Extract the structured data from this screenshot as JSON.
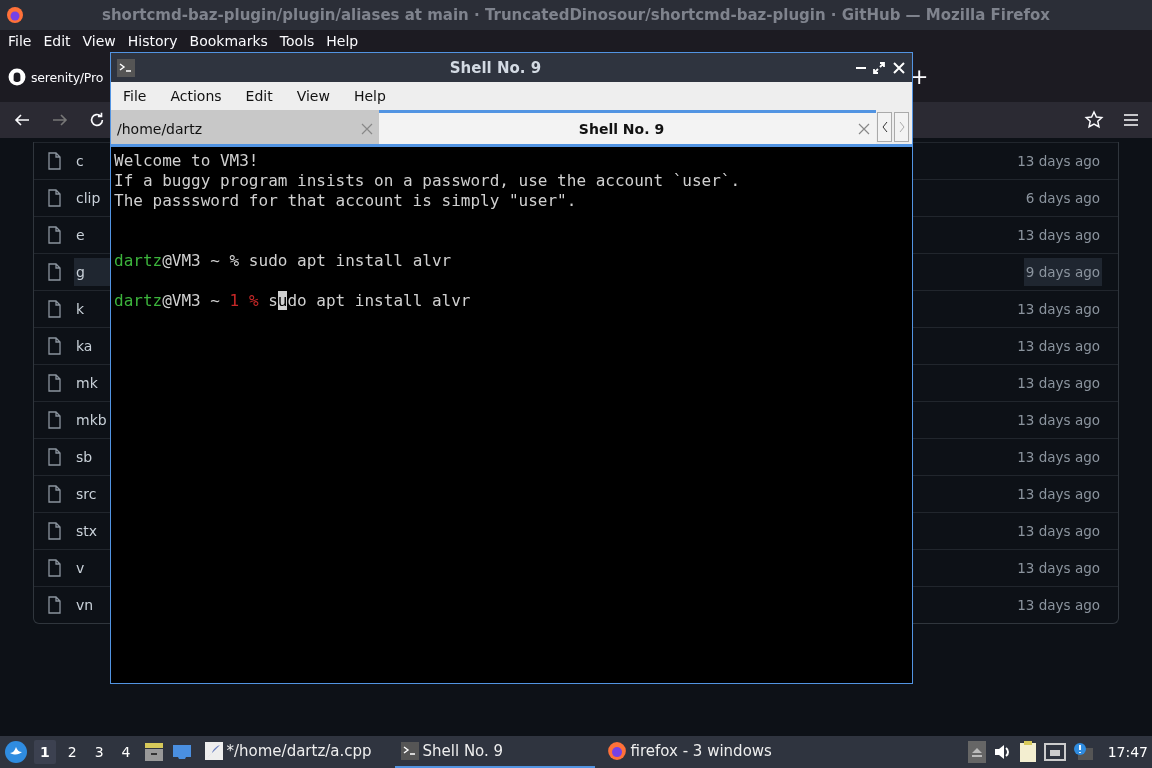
{
  "browser": {
    "title": "shortcmd-baz-plugin/plugin/aliases at main · TruncatedDinosour/shortcmd-baz-plugin · GitHub — Mozilla Firefox",
    "menu": [
      {
        "label": "File"
      },
      {
        "label": "Edit"
      },
      {
        "label": "View"
      },
      {
        "label": "History"
      },
      {
        "label": "Bookmarks"
      },
      {
        "label": "Tools"
      },
      {
        "label": "Help"
      }
    ],
    "tab": {
      "label": "serenity/Pro"
    },
    "new_tab": "+",
    "files": [
      {
        "name": "c",
        "time": "13 days ago",
        "hovered": false
      },
      {
        "name": "clip",
        "time": "6 days ago",
        "hovered": false
      },
      {
        "name": "e",
        "time": "13 days ago",
        "hovered": false
      },
      {
        "name": "g",
        "time": "9 days ago",
        "hovered": true
      },
      {
        "name": "k",
        "time": "13 days ago",
        "hovered": false
      },
      {
        "name": "ka",
        "time": "13 days ago",
        "hovered": false
      },
      {
        "name": "mk",
        "time": "13 days ago",
        "hovered": false
      },
      {
        "name": "mkb",
        "time": "13 days ago",
        "hovered": false
      },
      {
        "name": "sb",
        "time": "13 days ago",
        "hovered": false
      },
      {
        "name": "src",
        "time": "13 days ago",
        "hovered": false
      },
      {
        "name": "stx",
        "time": "13 days ago",
        "hovered": false
      },
      {
        "name": "v",
        "time": "13 days ago",
        "hovered": false
      },
      {
        "name": "vn",
        "time": "13 days ago",
        "hovered": false
      }
    ]
  },
  "terminal_window": {
    "title": "Shell No. 9",
    "menu": [
      {
        "label": "File"
      },
      {
        "label": "Actions"
      },
      {
        "label": "Edit"
      },
      {
        "label": "View"
      },
      {
        "label": "Help"
      }
    ],
    "tabs": [
      {
        "label": "/home/dartz",
        "selected": false
      },
      {
        "label": "Shell No. 9",
        "selected": true
      }
    ],
    "lines": [
      {
        "kind": "text",
        "segments": [
          {
            "text": "Welcome to VM3!",
            "color": "#d0d0d0",
            "cursor": false
          }
        ]
      },
      {
        "kind": "text",
        "segments": [
          {
            "text": "If a buggy program insists on a password, use the account `user`.",
            "color": "#d0d0d0",
            "cursor": false
          }
        ]
      },
      {
        "kind": "text",
        "segments": [
          {
            "text": "The passsword for that account is simply \"user\".",
            "color": "#d0d0d0",
            "cursor": false
          }
        ]
      },
      {
        "kind": "blank"
      },
      {
        "kind": "blank"
      },
      {
        "kind": "text",
        "segments": [
          {
            "text": "dartz",
            "color": "#3cb43c",
            "cursor": false
          },
          {
            "text": "@VM3 ~ % sudo apt install alvr",
            "color": "#d0d0d0",
            "cursor": false
          }
        ]
      },
      {
        "kind": "blank"
      },
      {
        "kind": "text",
        "segments": [
          {
            "text": "dartz",
            "color": "#3cb43c",
            "cursor": false
          },
          {
            "text": "@VM3 ~ ",
            "color": "#d0d0d0",
            "cursor": false
          },
          {
            "text": "1 %",
            "color": "#c82828",
            "cursor": false
          },
          {
            "text": " s",
            "color": "#d0d0d0",
            "cursor": false
          },
          {
            "text": "u",
            "color": "#d0d0d0",
            "cursor": true
          },
          {
            "text": "do apt install alvr",
            "color": "#d0d0d0",
            "cursor": false
          }
        ]
      }
    ]
  },
  "taskbar": {
    "workspaces": [
      {
        "label": "1",
        "selected": true
      },
      {
        "label": "2",
        "selected": false
      },
      {
        "label": "3",
        "selected": false
      },
      {
        "label": "4",
        "selected": false
      }
    ],
    "tasks": [
      {
        "label": "*/home/dartz/a.cpp",
        "kind": "editor",
        "selected": false
      },
      {
        "label": "Shell No. 9",
        "kind": "terminal",
        "selected": true
      },
      {
        "label": "firefox - 3 windows",
        "kind": "firefox",
        "selected": false
      }
    ],
    "clock": "17:47"
  }
}
